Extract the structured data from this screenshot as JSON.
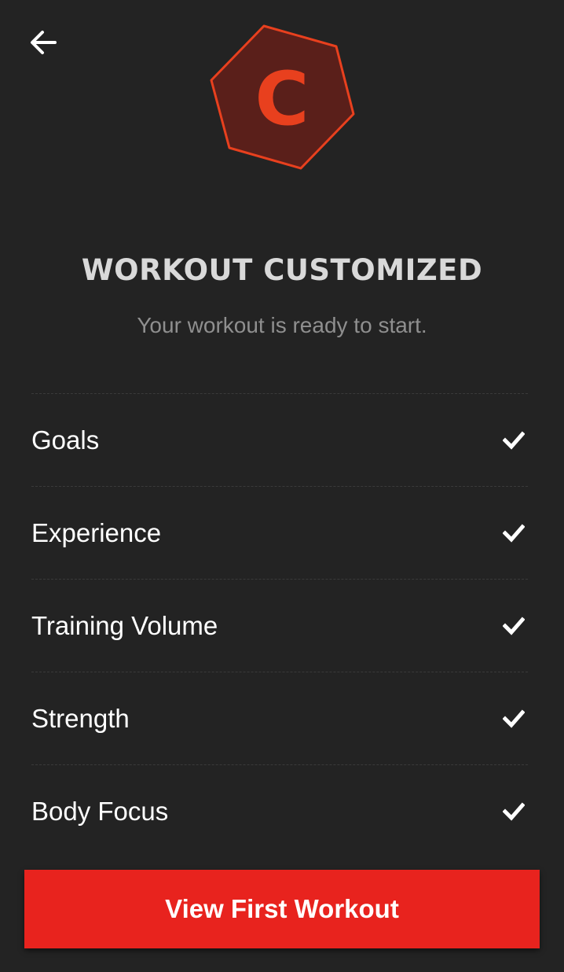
{
  "nav": {
    "back_icon": "arrow-left-icon"
  },
  "logo": {
    "letter": "C",
    "shape": "hexagon",
    "accent_color": "#e8401e",
    "fill_color": "#5a1f1a"
  },
  "header": {
    "title": "WORKOUT CUSTOMIZED",
    "subtitle": "Your workout is ready to start."
  },
  "checklist": {
    "items": [
      {
        "label": "Goals",
        "icon": "checkmark-icon"
      },
      {
        "label": "Experience",
        "icon": "checkmark-icon"
      },
      {
        "label": "Training Volume",
        "icon": "checkmark-icon"
      },
      {
        "label": "Strength",
        "icon": "checkmark-icon"
      },
      {
        "label": "Body Focus",
        "icon": "checkmark-icon"
      }
    ]
  },
  "cta": {
    "label": "View First Workout",
    "color": "#e8231e"
  }
}
